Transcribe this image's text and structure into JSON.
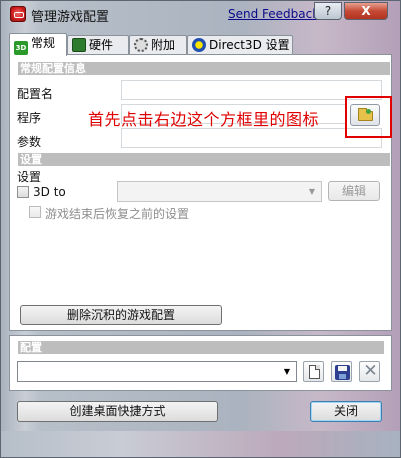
{
  "window": {
    "title": "管理游戏配置",
    "feedback_link": "Send Feedback",
    "help_label": "?",
    "close_label": "X"
  },
  "tabs": [
    {
      "label": "常规",
      "icon": "3d-icon",
      "active": true
    },
    {
      "label": "硬件",
      "icon": "hardware-icon",
      "active": false
    },
    {
      "label": "附加",
      "icon": "gear-icon",
      "active": false
    },
    {
      "label": "Direct3D 设置",
      "icon": "direct3d-icon",
      "active": false
    }
  ],
  "profile_section": {
    "header": "常规配置信息",
    "name_label": "配置名",
    "name_value": "",
    "program_label": "程序",
    "program_value": "",
    "params_label": "参数",
    "params_value": "",
    "browse_icon": "folder-open-icon"
  },
  "annotation": {
    "text": "首先点击右边这个方框里的图标",
    "color": "#e00000"
  },
  "settings_section": {
    "header": "设置",
    "label": "设置",
    "checkbox_3d_label": "3D to",
    "checkbox_3d_checked": false,
    "combo_value": "",
    "edit_button": "编辑",
    "restore_checkbox_label": "游戏结束后恢复之前的设置",
    "restore_checked": false,
    "delete_button": "删除沉积的游戏配置"
  },
  "config_section": {
    "header": "配置",
    "selected_value": "",
    "new_icon": "new-document-icon",
    "save_icon": "save-disk-icon",
    "delete_icon": "delete-x-icon"
  },
  "footer": {
    "shortcut_button": "创建桌面快捷方式",
    "close_button": "关闭"
  }
}
